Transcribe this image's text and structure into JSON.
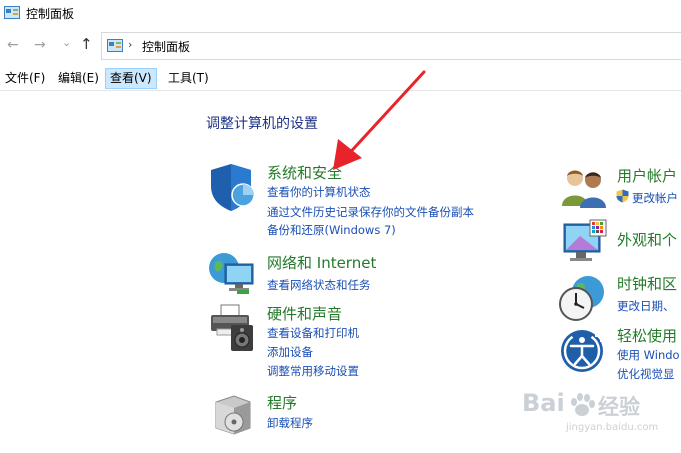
{
  "window": {
    "title": "控制面板"
  },
  "nav": {
    "back": "←",
    "forward": "→",
    "dropdown": "⌄",
    "up": "↑"
  },
  "address": {
    "chevron": "›",
    "path": "控制面板"
  },
  "menu": [
    "文件(F)",
    "编辑(E)",
    "查看(V)",
    "工具(T)"
  ],
  "main": {
    "heading": "调整计算机的设置",
    "left_categories": [
      {
        "title": "系统和安全",
        "links": [
          "查看你的计算机状态",
          "通过文件历史记录保存你的文件备份副本",
          "备份和还原(Windows 7)"
        ]
      },
      {
        "title": "网络和 Internet",
        "links": [
          "查看网络状态和任务"
        ]
      },
      {
        "title": "硬件和声音",
        "links": [
          "查看设备和打印机",
          "添加设备",
          "调整常用移动设置"
        ]
      },
      {
        "title": "程序",
        "links": [
          "卸载程序"
        ]
      }
    ],
    "right_categories": [
      {
        "title": "用户帐户",
        "links": [
          "更改帐户"
        ]
      },
      {
        "title": "外观和个",
        "links": []
      },
      {
        "title": "时钟和区",
        "links": [
          "更改日期、"
        ]
      },
      {
        "title": "轻松使用",
        "links": [
          "使用 Windo",
          "优化视觉显"
        ]
      }
    ]
  },
  "watermark": {
    "brand": "Bai",
    "brand_tail": "经验",
    "url": "jingyan.baidu.com"
  },
  "colors": {
    "category_title": "#247a2a",
    "link": "#1a4fb5",
    "heading": "#1e3287",
    "annotation_arrow": "#e8232a"
  }
}
